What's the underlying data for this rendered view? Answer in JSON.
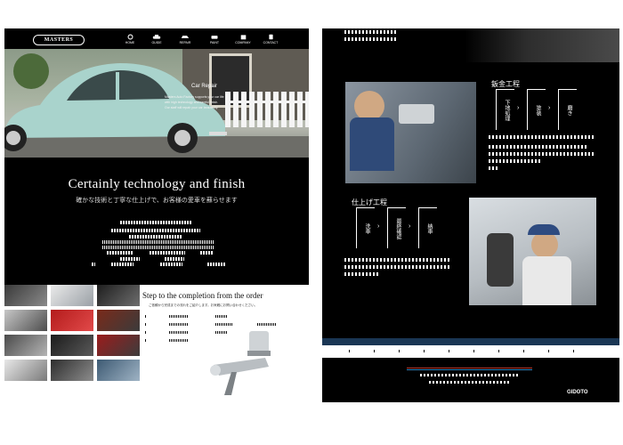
{
  "left_page": {
    "brand": {
      "logo_text": "MASTERS",
      "logo_sub": "AUTO FACTORY"
    },
    "nav": [
      {
        "label": "HOME",
        "icon": "wrench-icon"
      },
      {
        "label": "GUIDE",
        "icon": "car-icon"
      },
      {
        "label": "REPAIR",
        "icon": "car-side-icon"
      },
      {
        "label": "PAINT",
        "icon": "car-front-icon"
      },
      {
        "label": "COMPANY",
        "icon": "building-icon"
      },
      {
        "label": "CONTACT",
        "icon": "phone-icon"
      }
    ],
    "hero": {
      "heading": "Car Repair",
      "line1": "Masters Auto Factory supports your car life",
      "line2": "with high technology and careful finish.",
      "line3": "Our staff will repair your car beautifully."
    },
    "main_title": "Certainly technology and finish",
    "main_subtitle": "確かな技術と丁寧な仕上げで、お客様の愛車を蘇らせます",
    "step_section": {
      "title": "Step to the completion from the order",
      "subtitle": "ご依頼から完成までの流れをご紹介します。お気軽にお問い合わせください。"
    }
  },
  "right_page": {
    "section1_title": "鈑金工程",
    "section1_steps": [
      "下地処理",
      "塗装",
      "磨き"
    ],
    "section2_title": "仕上げ工程",
    "section2_steps": [
      "洗車",
      "最終確認",
      "納車"
    ],
    "footer_brand": "GIDOTO"
  },
  "colors": {
    "background": "#000000",
    "accent_blue": "#1a3654",
    "red_line": "#c0392b",
    "blue_line": "#2e86c1"
  }
}
